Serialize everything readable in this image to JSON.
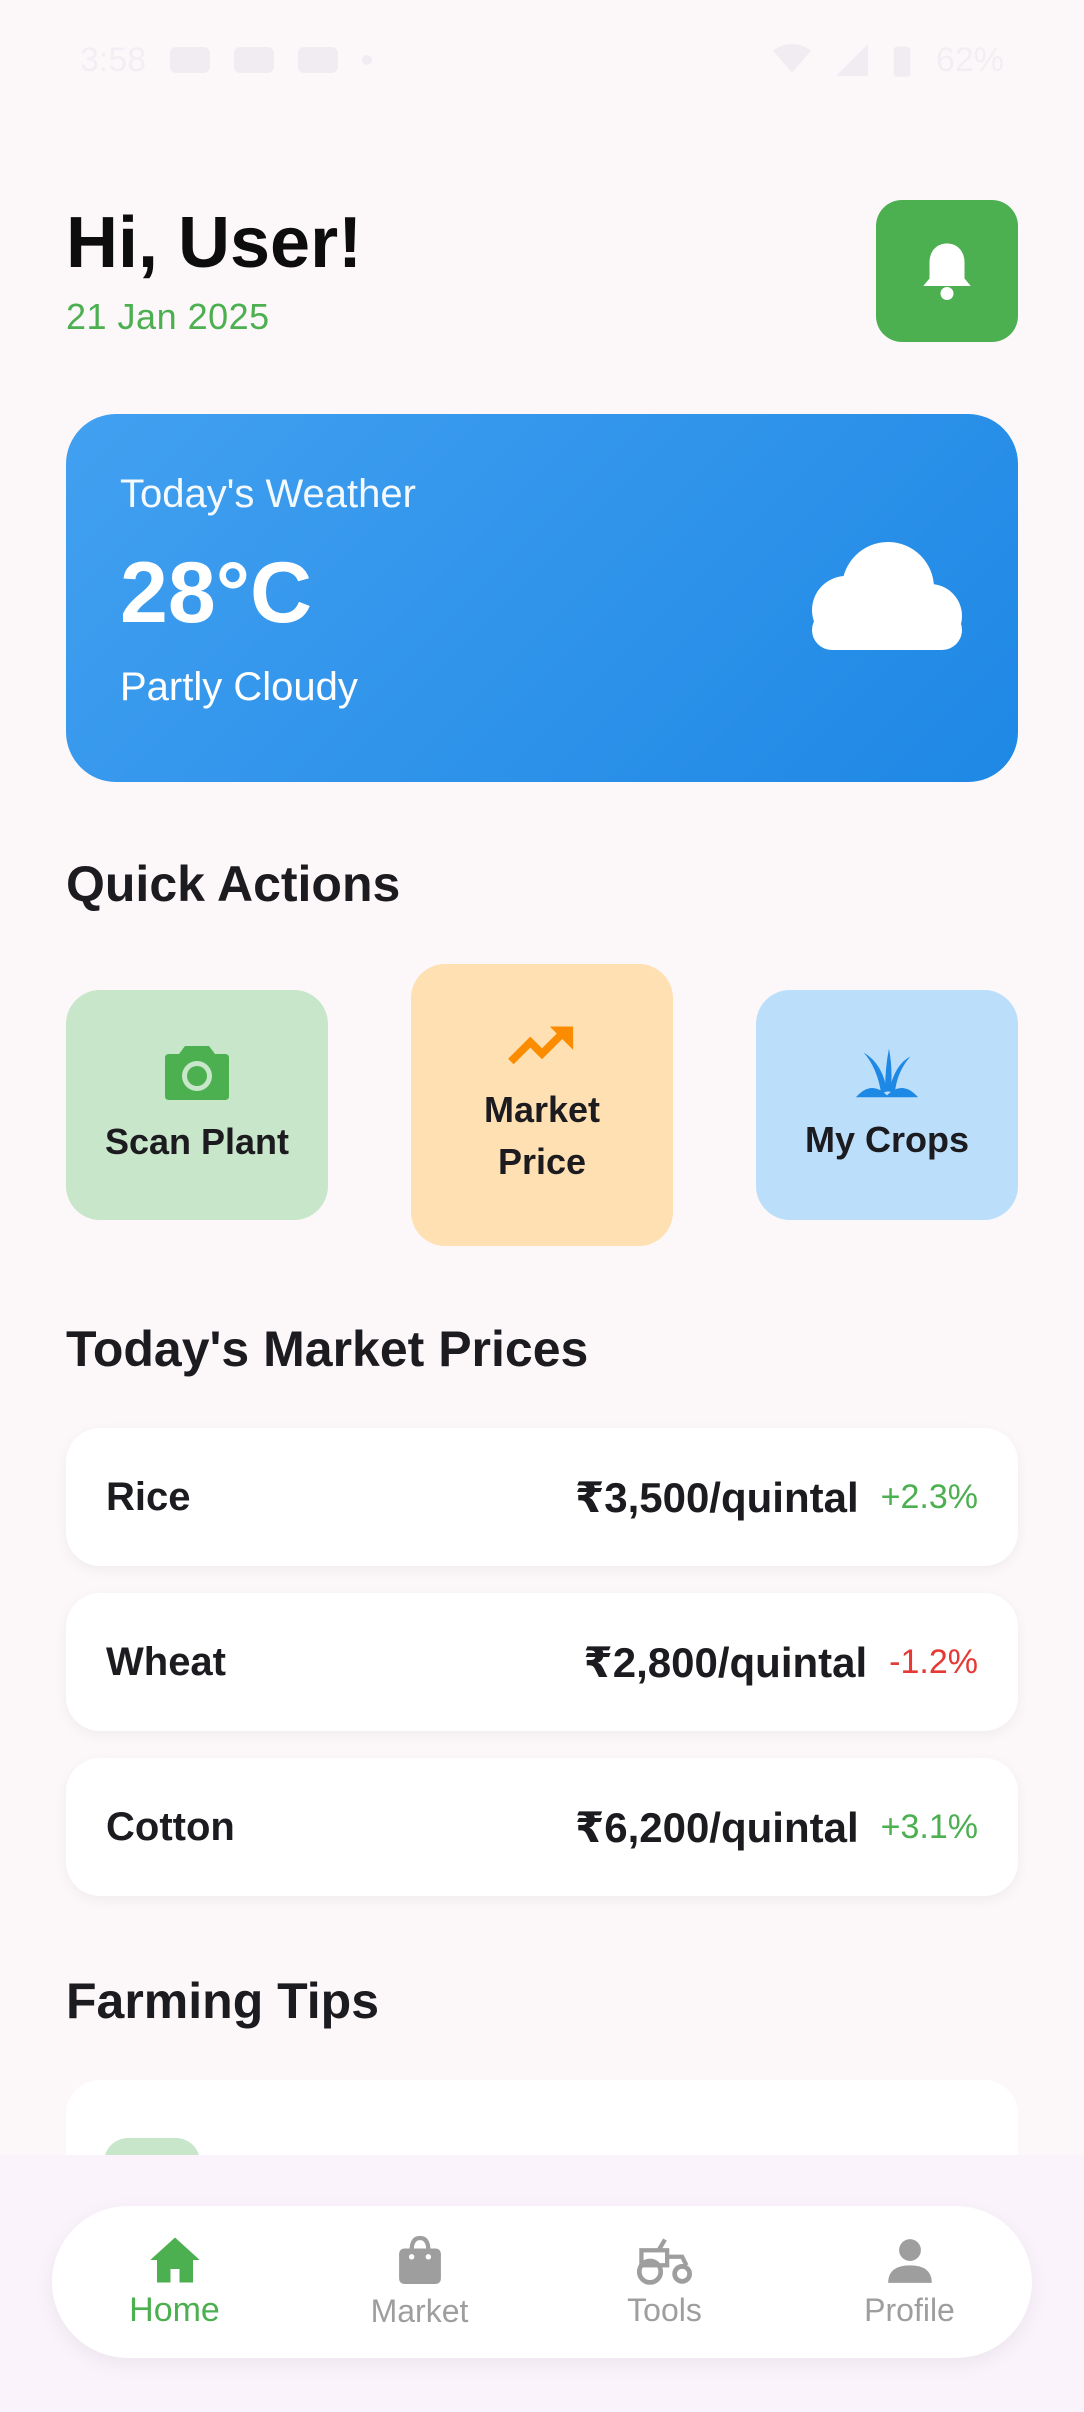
{
  "status": {
    "time": "3:58",
    "battery": "62%"
  },
  "header": {
    "greeting": "Hi, User!",
    "date": "21 Jan 2025"
  },
  "weather": {
    "label": "Today's Weather",
    "temperature": "28°C",
    "condition": "Partly Cloudy"
  },
  "quick_actions": {
    "title": "Quick Actions",
    "items": [
      {
        "label": "Scan Plant",
        "color": "#c8e6c9",
        "icon": "camera-icon"
      },
      {
        "label": "Market Price",
        "color": "#ffe0b2",
        "icon": "trending-up-icon"
      },
      {
        "label": "My Crops",
        "color": "#bbdefb",
        "icon": "grass-icon"
      }
    ]
  },
  "market": {
    "title": "Today's Market Prices",
    "rows": [
      {
        "crop": "Rice",
        "price": "₹3,500/quintal",
        "change": "+2.3%",
        "direction": "up"
      },
      {
        "crop": "Wheat",
        "price": "₹2,800/quintal",
        "change": "-1.2%",
        "direction": "down"
      },
      {
        "crop": "Cotton",
        "price": "₹6,200/quintal",
        "change": "+3.1%",
        "direction": "up"
      }
    ]
  },
  "tips": {
    "title": "Farming Tips"
  },
  "nav": {
    "items": [
      {
        "label": "Home",
        "icon": "home-icon",
        "active": true
      },
      {
        "label": "Market",
        "icon": "shopping-bag-icon",
        "active": false
      },
      {
        "label": "Tools",
        "icon": "tractor-icon",
        "active": false
      },
      {
        "label": "Profile",
        "icon": "person-icon",
        "active": false
      }
    ]
  },
  "colors": {
    "primary": "#4caf50",
    "weather_start": "#42a0f0",
    "weather_end": "#1e88e5",
    "accent_orange": "#fb8c00",
    "accent_blue": "#1e88e5",
    "negative": "#e53935"
  }
}
